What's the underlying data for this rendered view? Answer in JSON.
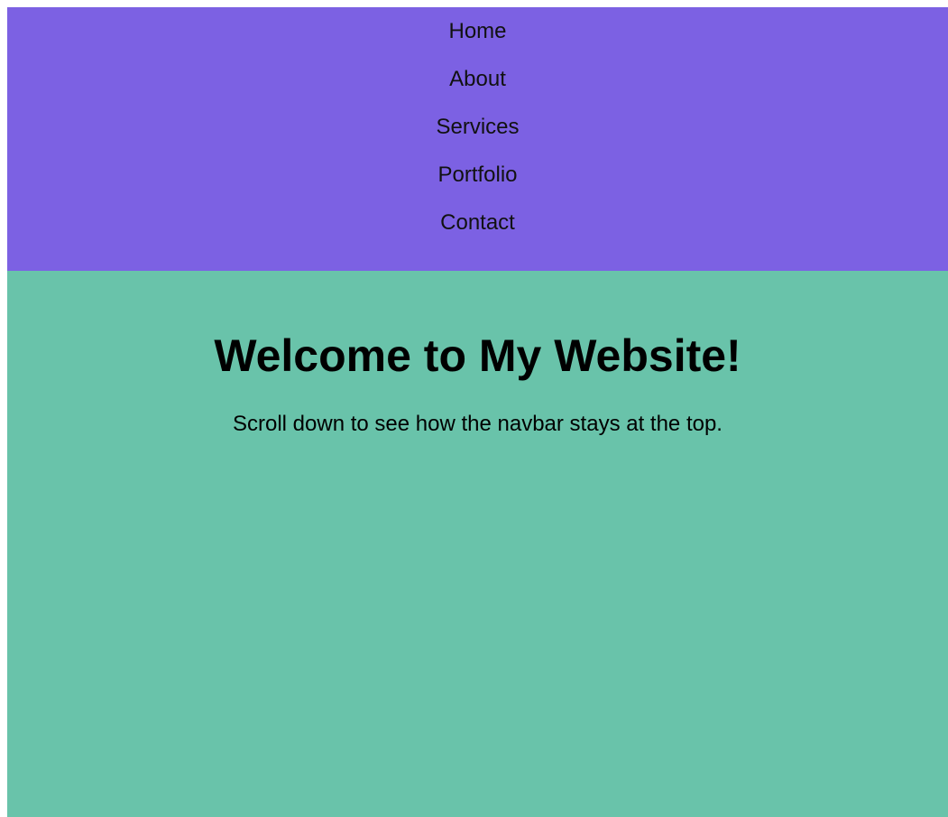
{
  "navbar": {
    "items": [
      {
        "label": "Home"
      },
      {
        "label": "About"
      },
      {
        "label": "Services"
      },
      {
        "label": "Portfolio"
      },
      {
        "label": "Contact"
      }
    ],
    "background": "#7c61e3"
  },
  "main": {
    "title": "Welcome to My Website!",
    "subtitle": "Scroll down to see how the navbar stays at the top.",
    "background": "#69c3aa"
  }
}
